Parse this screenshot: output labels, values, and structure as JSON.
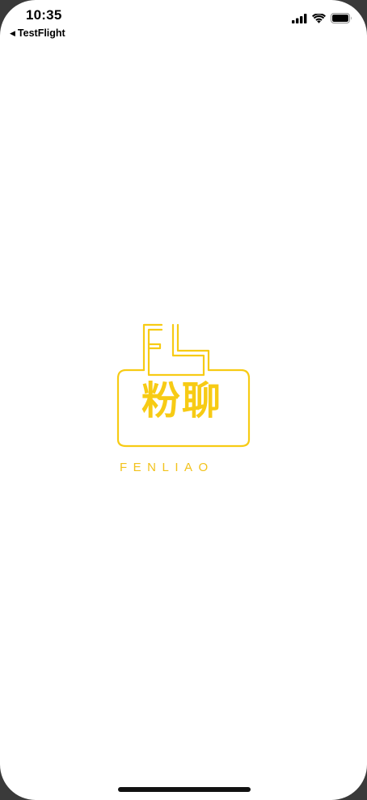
{
  "status_bar": {
    "time": "10:35",
    "back_app": "TestFlight",
    "back_glyph": "◀",
    "icons": [
      "cellular-signal-icon",
      "wifi-icon",
      "battery-icon"
    ]
  },
  "splash": {
    "logo_mark": "FL",
    "brand_cn": "粉聊",
    "brand_en": "FENLIAO"
  },
  "colors": {
    "brand_yellow": "#F7CB14",
    "background": "#FFFFFF",
    "text": "#000000"
  }
}
